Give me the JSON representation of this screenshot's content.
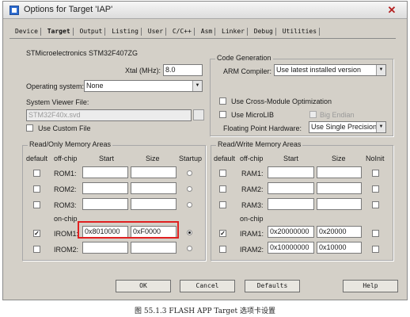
{
  "window": {
    "title": "Options for Target 'IAP'"
  },
  "tabs": [
    "Device",
    "Target",
    "Output",
    "Listing",
    "User",
    "C/C++",
    "Asm",
    "Linker",
    "Debug",
    "Utilities"
  ],
  "active_tab": "Target",
  "device": "STMicroelectronics STM32F407ZG",
  "xtal": {
    "label": "Xtal (MHz):",
    "value": "8.0"
  },
  "os": {
    "label": "Operating system:",
    "value": "None"
  },
  "svf": {
    "label": "System Viewer File:",
    "value": "STM32F40x.svd"
  },
  "use_custom_file": "Use Custom File",
  "code_gen": {
    "title": "Code Generation",
    "arm_compiler_label": "ARM Compiler:",
    "arm_compiler_value": "Use latest installed version",
    "cross_module": "Use Cross-Module Optimization",
    "microlib": "Use MicroLIB",
    "big_endian": "Big Endian",
    "fp_label": "Floating Point Hardware:",
    "fp_value": "Use Single Precision"
  },
  "rom": {
    "title": "Read/Only Memory Areas",
    "headers": {
      "default": "default",
      "offchip": "off-chip",
      "start": "Start",
      "size": "Size",
      "startup": "Startup"
    },
    "onchip": "on-chip",
    "rows": [
      {
        "name": "ROM1:",
        "start": "",
        "size": "",
        "default": false,
        "startup": false
      },
      {
        "name": "ROM2:",
        "start": "",
        "size": "",
        "default": false,
        "startup": false
      },
      {
        "name": "ROM3:",
        "start": "",
        "size": "",
        "default": false,
        "startup": false
      },
      {
        "name": "IROM1:",
        "start": "0x8010000",
        "size": "0xF0000",
        "default": true,
        "startup": true
      },
      {
        "name": "IROM2:",
        "start": "",
        "size": "",
        "default": false,
        "startup": false
      }
    ]
  },
  "ram": {
    "title": "Read/Write Memory Areas",
    "headers": {
      "default": "default",
      "offchip": "off-chip",
      "start": "Start",
      "size": "Size",
      "noinit": "NoInit"
    },
    "onchip": "on-chip",
    "rows": [
      {
        "name": "RAM1:",
        "start": "",
        "size": "",
        "default": false
      },
      {
        "name": "RAM2:",
        "start": "",
        "size": "",
        "default": false
      },
      {
        "name": "RAM3:",
        "start": "",
        "size": "",
        "default": false
      },
      {
        "name": "IRAM1:",
        "start": "0x20000000",
        "size": "0x20000",
        "default": true
      },
      {
        "name": "IRAM2:",
        "start": "0x10000000",
        "size": "0x10000",
        "default": false
      }
    ]
  },
  "buttons": {
    "ok": "OK",
    "cancel": "Cancel",
    "defaults": "Defaults",
    "help": "Help"
  },
  "caption": "图 55.1.3 FLASH APP Target 选项卡设置"
}
